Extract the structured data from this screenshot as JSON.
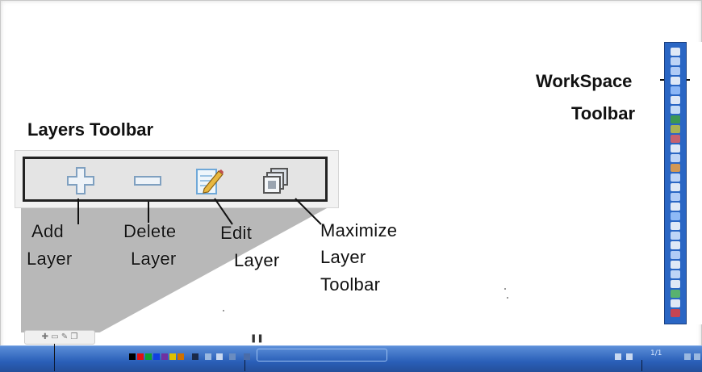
{
  "headings": {
    "layers_toolbar": "Layers Toolbar",
    "workspace_line1": "WorkSpace",
    "workspace_line2": "Toolbar"
  },
  "layers_toolbar": {
    "buttons": [
      {
        "icon": "add-layer-icon",
        "label_lines": [
          "Add",
          "Layer"
        ]
      },
      {
        "icon": "delete-layer-icon",
        "label_lines": [
          "Delete",
          "Layer"
        ]
      },
      {
        "icon": "edit-layer-icon",
        "label_lines": [
          "Edit",
          "Layer"
        ]
      },
      {
        "icon": "maximize-layer-toolbar-icon",
        "label_lines": [
          "Maximize",
          "Layer",
          "Toolbar"
        ]
      }
    ]
  },
  "workspace_toolbar": {
    "accent": "#2a66c4"
  },
  "taskbar": {
    "page_indicator": "1/1",
    "accent": "#2a5fb8"
  },
  "colors": {
    "callout_wedge": "#b8b8b8",
    "toolbar_border": "#222222",
    "palette": [
      "#000000",
      "#e01010",
      "#10a030",
      "#1040e0",
      "#e0c000",
      "#d07000"
    ]
  }
}
